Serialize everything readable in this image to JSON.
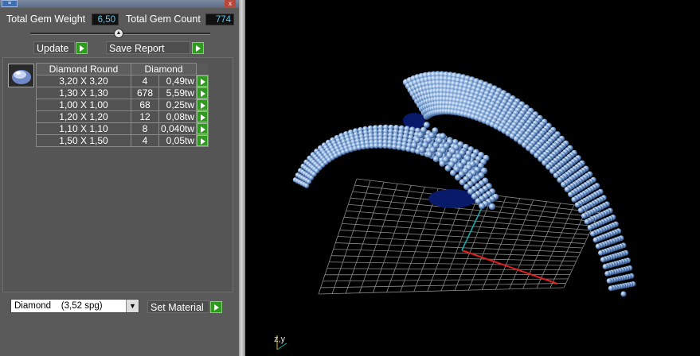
{
  "window": {
    "icon": "app-icon",
    "close_label": "x"
  },
  "stats": {
    "total_gem_weight_label": "Total Gem Weight",
    "total_gem_weight_value": "6,50",
    "total_gem_count_label": "Total Gem Count",
    "total_gem_count_value": "774"
  },
  "toolbar": {
    "update_label": "Update",
    "save_report_label": "Save Report"
  },
  "gem_table": {
    "columns": [
      "Diamond Round",
      "Diamond"
    ],
    "rows": [
      {
        "size": "3,20 X 3,20",
        "count": "4",
        "weight": "0,49tw"
      },
      {
        "size": "1,30 X 1,30",
        "count": "678",
        "weight": "5,59tw"
      },
      {
        "size": "1,00 X 1,00",
        "count": "68",
        "weight": "0,25tw"
      },
      {
        "size": "1,20 X 1,20",
        "count": "12",
        "weight": "0,08tw"
      },
      {
        "size": "1,10 X 1,10",
        "count": "8",
        "weight": "0,040tw"
      },
      {
        "size": "1,50 X 1,50",
        "count": "4",
        "weight": "0,05tw"
      }
    ]
  },
  "material": {
    "selected": "Diamond    (3,52 spg)",
    "set_label": "Set Material"
  },
  "viewport": {
    "axis_label": "z,y"
  },
  "colors": {
    "accent_green": "#2f9a1f",
    "value_text": "#5ec8f0",
    "gem_blue": "#8fb4e0",
    "axis_red": "#e02020"
  }
}
